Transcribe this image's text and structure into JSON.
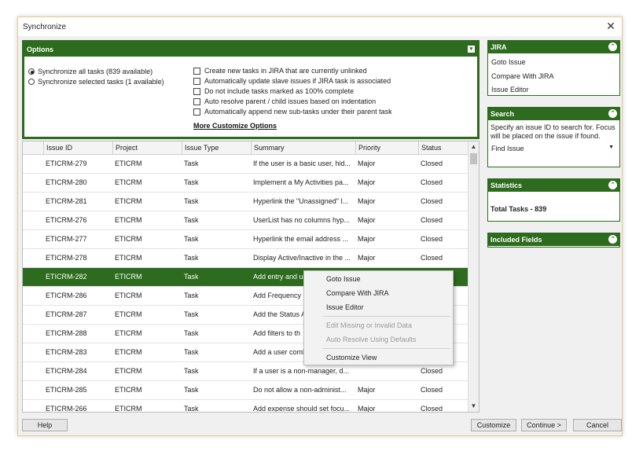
{
  "window": {
    "title": "Synchronize",
    "close_glyph": "✕"
  },
  "options": {
    "title": "Options",
    "radios": [
      {
        "label": "Synchronize all tasks (839 available)",
        "checked": true
      },
      {
        "label": "Synchronize selected tasks (1 available)",
        "checked": false
      }
    ],
    "checkboxes": [
      "Create new tasks in JIRA that are currently unlinked",
      "Automatically update slave issues if JIRA task is associated",
      "Do not include tasks marked as 100% complete",
      "Auto resolve parent / child issues based on indentation",
      "Automatically append new sub-tasks under their parent task"
    ],
    "more_link": "More Customize Options"
  },
  "grid": {
    "columns": [
      "Issue ID",
      "Project",
      "Issue Type",
      "Summary",
      "Priority",
      "Status"
    ],
    "rows": [
      [
        "ETICRM-279",
        "ETICRM",
        "Task",
        "If the user is a basic user, hid...",
        "Major",
        "Closed"
      ],
      [
        "ETICRM-280",
        "ETICRM",
        "Task",
        "Implement a My Activities pa...",
        "Major",
        "Closed"
      ],
      [
        "ETICRM-281",
        "ETICRM",
        "Task",
        "Hyperlink the \"Unassigned\" l...",
        "Major",
        "Closed"
      ],
      [
        "ETICRM-276",
        "ETICRM",
        "Task",
        "UserList has no columns hyp...",
        "Major",
        "Closed"
      ],
      [
        "ETICRM-277",
        "ETICRM",
        "Task",
        "Hyperlink the email address ...",
        "Major",
        "Closed"
      ],
      [
        "ETICRM-278",
        "ETICRM",
        "Task",
        "Display Active/Inactive in the ...",
        "Major",
        "Closed"
      ],
      [
        "ETICRM-282",
        "ETICRM",
        "Task",
        "Add entry and u",
        "",
        ""
      ],
      [
        "ETICRM-286",
        "ETICRM",
        "Task",
        "Add Frequency",
        "",
        ""
      ],
      [
        "ETICRM-287",
        "ETICRM",
        "Task",
        "Add the Status A",
        "",
        ""
      ],
      [
        "ETICRM-288",
        "ETICRM",
        "Task",
        "Add filters to th",
        "",
        ""
      ],
      [
        "ETICRM-283",
        "ETICRM",
        "Task",
        "Add a user coml",
        "",
        ""
      ],
      [
        "ETICRM-284",
        "ETICRM",
        "Task",
        "If a user is a non-manager, d...",
        "",
        "Closed"
      ],
      [
        "ETICRM-285",
        "ETICRM",
        "Task",
        "Do not allow a non-administ...",
        "Major",
        "Closed"
      ],
      [
        "ETICRM-266",
        "ETICRM",
        "Task",
        "Add expense should set focu...",
        "Major",
        "Closed"
      ]
    ],
    "selected_index": 6
  },
  "context_menu": {
    "items": [
      {
        "label": "Goto Issue",
        "disabled": false
      },
      {
        "label": "Compare With JIRA",
        "disabled": false
      },
      {
        "label": "Issue Editor",
        "disabled": false
      },
      {
        "label": "Edit Missing or Invalid Data",
        "disabled": true
      },
      {
        "label": "Auto Resolve Using Defaults",
        "disabled": true
      },
      {
        "label": "Customize View",
        "disabled": false
      }
    ]
  },
  "panels": {
    "jira": {
      "title": "JIRA",
      "items": [
        "Goto Issue",
        "Compare With JIRA",
        "Issue Editor"
      ]
    },
    "search": {
      "title": "Search",
      "description": "Specify an issue ID to search for. Focus will be placed on the issue if found.",
      "select_value": "Find Issue"
    },
    "statistics": {
      "title": "Statistics",
      "total": "Total Tasks - 839"
    },
    "included_fields": {
      "title": "Included Fields"
    }
  },
  "buttons": {
    "help": "Help",
    "customize": "Customize",
    "continue": "Continue >",
    "cancel": "Cancel"
  },
  "colors": {
    "accent": "#2d6b1e"
  }
}
